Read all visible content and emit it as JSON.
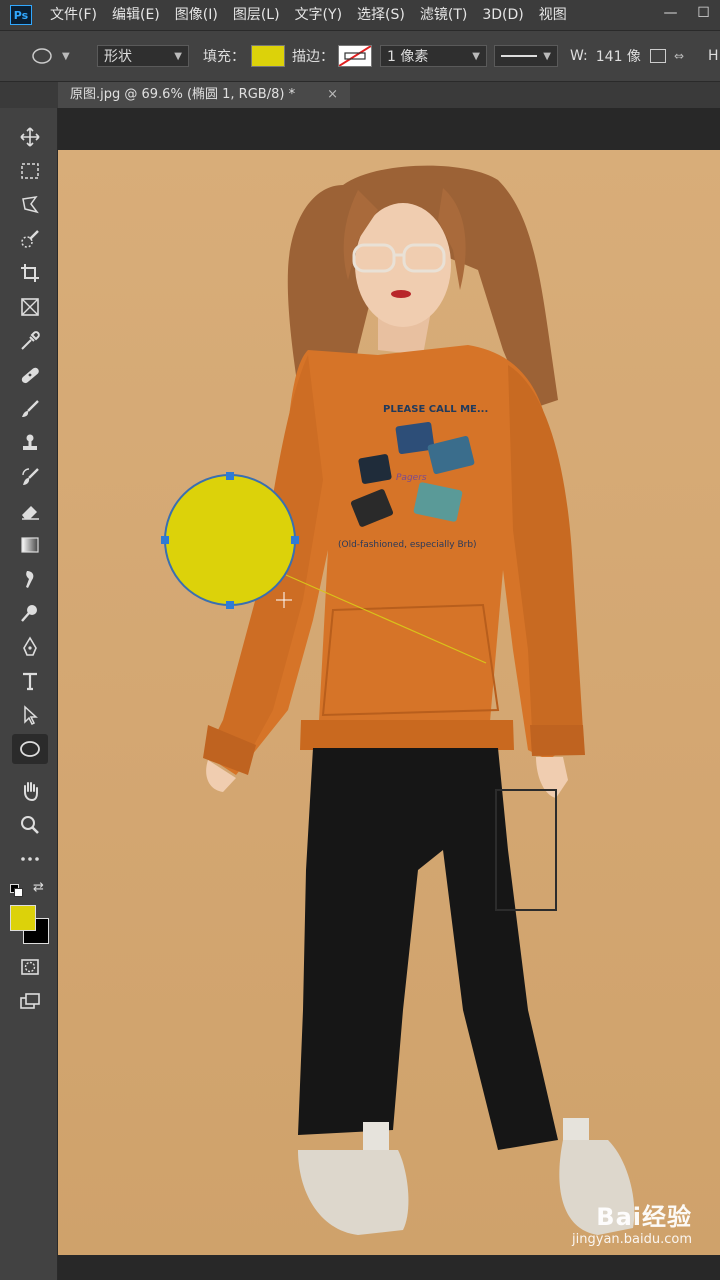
{
  "app": {
    "logo": "Ps"
  },
  "menu": {
    "items": [
      "文件(F)",
      "编辑(E)",
      "图像(I)",
      "图层(L)",
      "文字(Y)",
      "选择(S)",
      "滤镜(T)",
      "3D(D)",
      "视图"
    ]
  },
  "window_controls": {
    "minimize": "—",
    "restore": "☐"
  },
  "options_bar": {
    "mode": "形状",
    "fill_label": "填充：",
    "fill_color": "#dcd20a",
    "stroke_label": "描边：",
    "stroke_width": "1 像素",
    "w_label": "W:",
    "w_value": "141 像",
    "h_label": "H:"
  },
  "document_tab": {
    "title": "原图.jpg @ 69.6% (椭圆 1, RGB/8) *",
    "close": "×"
  },
  "toolbar": {
    "collapse": "»",
    "tools": [
      "move-tool",
      "marquee-tool",
      "lasso-tool",
      "quick-select-tool",
      "crop-tool",
      "frame-tool",
      "eyedropper-tool",
      "healing-tool",
      "brush-tool",
      "stamp-tool",
      "history-brush-tool",
      "eraser-tool",
      "gradient-tool",
      "smudge-tool",
      "dodge-tool",
      "pen-tool",
      "type-tool",
      "path-select-tool",
      "ellipse-tool",
      "hand-tool",
      "zoom-tool",
      "more-tools"
    ],
    "active_tool": "ellipse-tool",
    "foreground_color": "#dcd20a",
    "background_color": "#000000"
  },
  "canvas": {
    "photo_background": "#d6aa74",
    "shirt_text_top": "PLEASE CALL ME...",
    "shirt_text_bottom": "(Old-fashioned, especially Brb)",
    "shirt_label": "Pagers",
    "ellipse_fill": "#dcd20a",
    "ellipse_stroke": "#3a6fb0"
  },
  "watermark": {
    "main": "Bai经验",
    "sub": "jingyan.baidu.com"
  }
}
